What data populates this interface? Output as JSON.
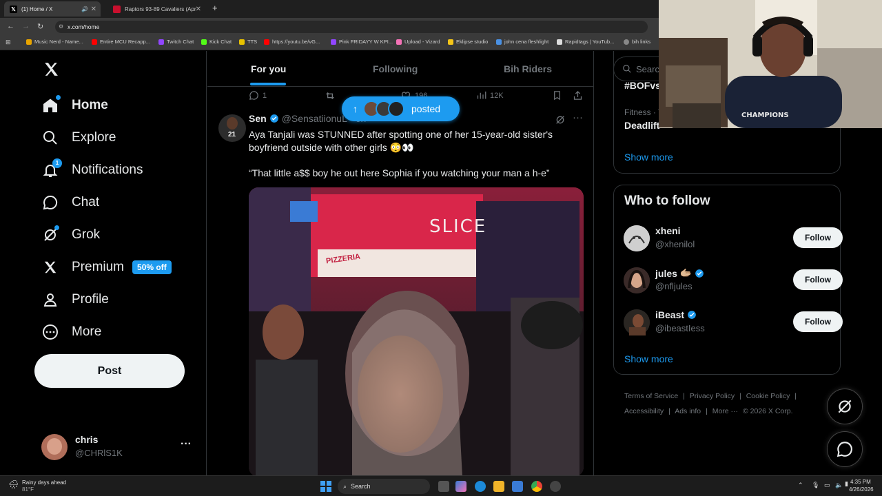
{
  "browser": {
    "tabs": [
      {
        "title": "(1) Home / X",
        "active": true
      },
      {
        "title": "Raptors 93-89 Cavaliers (Apr 2",
        "active": false
      }
    ],
    "new_tab": "+",
    "url": "x.com/home",
    "bookmarks": [
      "Music Nerd - Name...",
      "Entire MCU Recapp...",
      "Twitch Chat",
      "Kick Chat",
      "TTS",
      "https://youtu.be/vG...",
      "Pink FRIDAYY W KPI...",
      "Upload - Vizard",
      "Eklipse studio",
      "john cena fleshlight",
      "Rapidtags | YouTub...",
      "bih links"
    ]
  },
  "sidebar": {
    "items": [
      {
        "label": "Home",
        "icon": "home-icon"
      },
      {
        "label": "Explore",
        "icon": "search-icon"
      },
      {
        "label": "Notifications",
        "icon": "bell-icon",
        "badge": "1"
      },
      {
        "label": "Chat",
        "icon": "chat-icon"
      },
      {
        "label": "Grok",
        "icon": "grok-icon"
      },
      {
        "label": "Premium",
        "icon": "x-logo-icon",
        "pill": "50% off"
      },
      {
        "label": "Profile",
        "icon": "profile-icon"
      },
      {
        "label": "More",
        "icon": "more-circle-icon"
      }
    ],
    "post_label": "Post",
    "account": {
      "name": "chris",
      "handle": "@CHRlS1K",
      "menu": "···"
    }
  },
  "feed": {
    "tabs": [
      "For you",
      "Following",
      "Bih Riders"
    ],
    "prev_actions": {
      "replies": "1",
      "likes": "196",
      "views": "12K"
    },
    "posted_pill": "posted",
    "tweet": {
      "author": "Sen",
      "handle": "@SensatiionuL · 6h",
      "text1": "Aya Tanjali was STUNNED after spotting one of her 15-year-old sister's boyfriend outside with other girls 😳👀",
      "text2": "“That little a$$ boy he out here Sophia if you watching your man a h-e”",
      "media_sign": "SLICE",
      "media_sign2": "PIZZERIA"
    }
  },
  "right": {
    "search_placeholder": "Search",
    "trending": {
      "category": "Fitness · Trending",
      "topic": "Deadlift",
      "hashtag": "#BOFvs",
      "show_more": "Show more"
    },
    "who_to_follow": {
      "title": "Who to follow",
      "people": [
        {
          "name": "xheni",
          "handle": "@xhenilol",
          "verified": false,
          "emoji": ""
        },
        {
          "name": "jules",
          "handle": "@nfljules",
          "verified": true,
          "emoji": "🫱🏼"
        },
        {
          "name": "iBeast",
          "handle": "@ibeastIess",
          "verified": true,
          "emoji": ""
        }
      ],
      "follow_label": "Follow",
      "show_more": "Show more"
    },
    "footer": [
      "Terms of Service",
      "|",
      "Privacy Policy",
      "|",
      "Cookie Policy",
      "|",
      "Accessibility",
      "|",
      "Ads info",
      "|",
      "More ···",
      "© 2026 X Corp."
    ]
  },
  "taskbar": {
    "weather_title": "Rainy days ahead",
    "weather_temp": "81°F",
    "search": "Search",
    "time": "4:35 PM",
    "date": "4/26/2026"
  },
  "colors": {
    "accent": "#1d9bf0",
    "bg": "#000000",
    "muted": "#71767b"
  }
}
